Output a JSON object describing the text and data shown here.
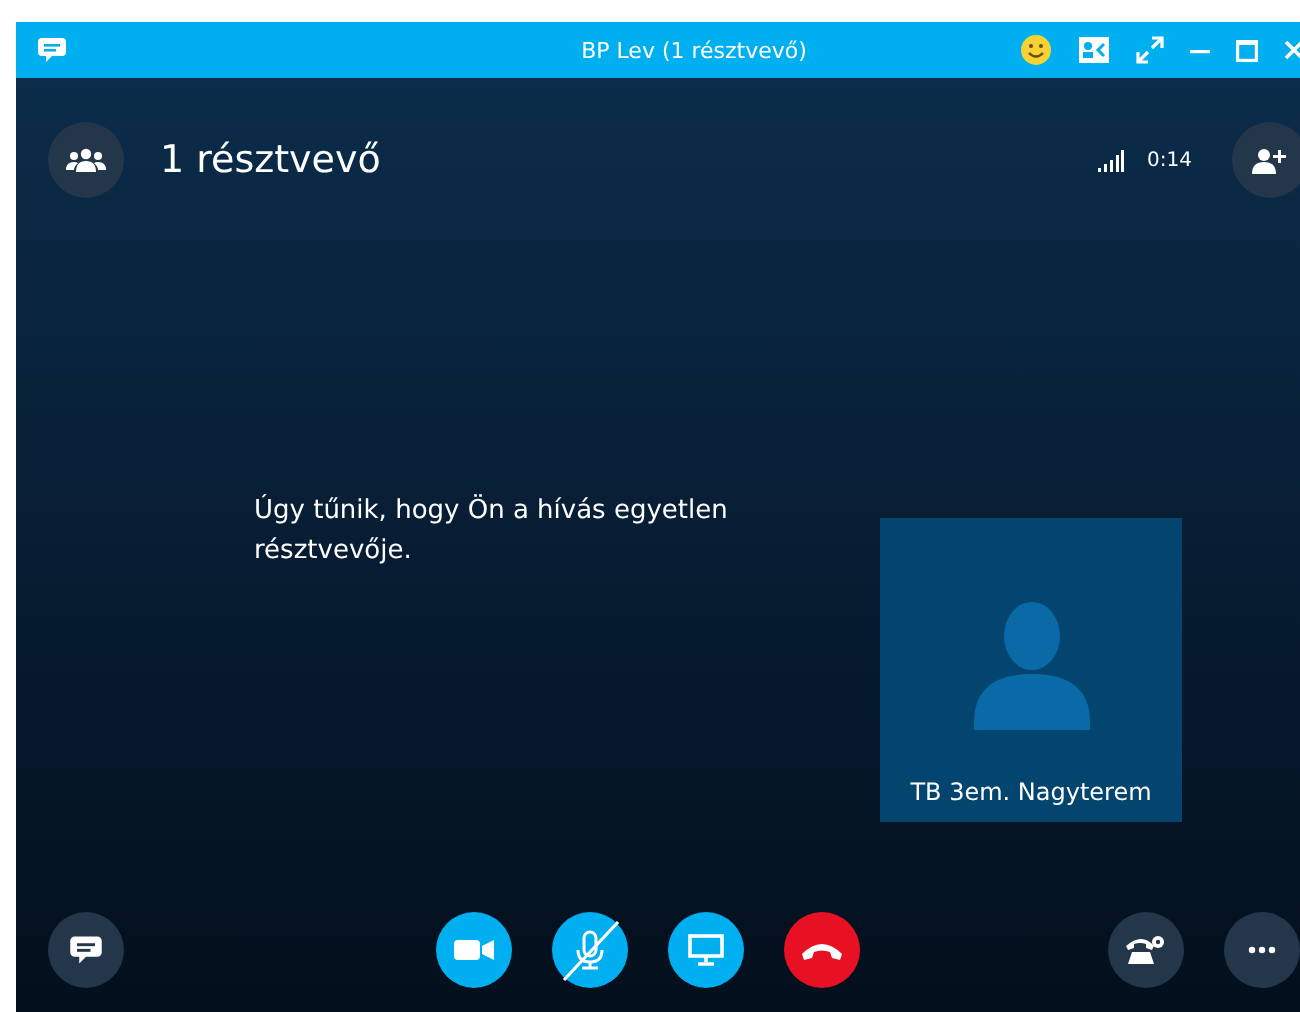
{
  "window": {
    "title": "BP Lev (1 résztvevő)"
  },
  "header": {
    "participants": "1 résztvevő",
    "call_time": "0:14"
  },
  "message": "Úgy tűnik, hogy Ön a hívás egyetlen résztvevője.",
  "tile": {
    "name": "TB 3em. Nagyterem"
  },
  "controls": {
    "camera_on": false,
    "mic_muted": true
  }
}
